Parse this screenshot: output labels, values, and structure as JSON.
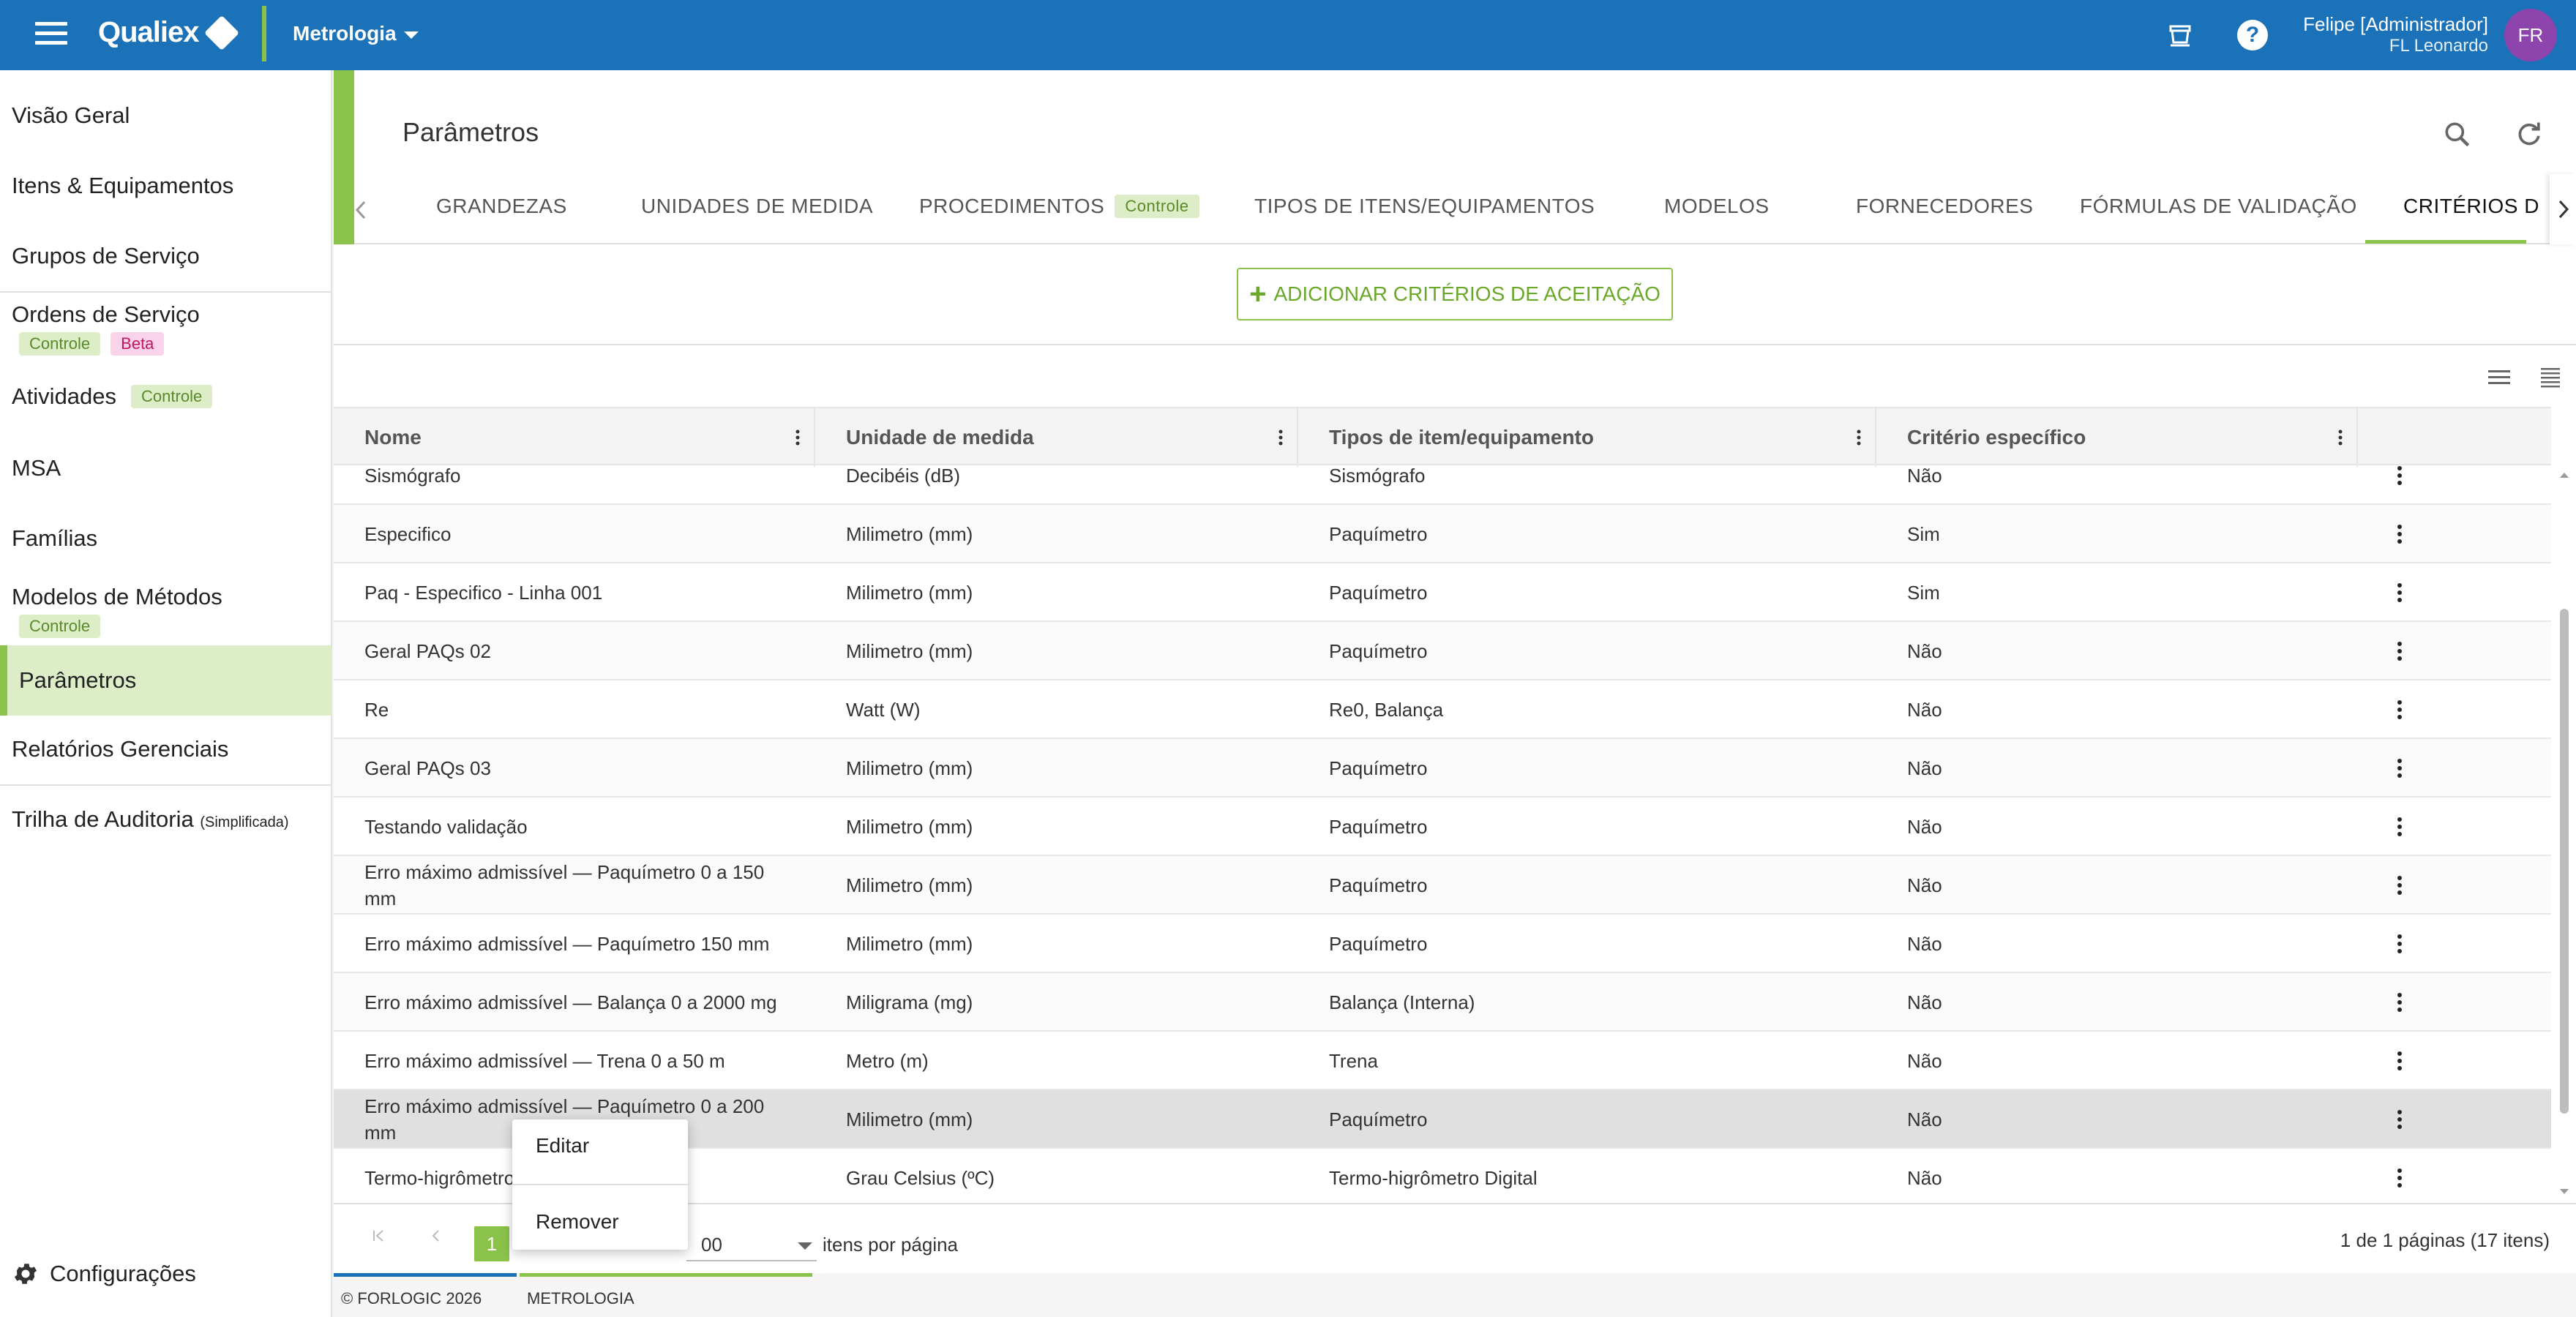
{
  "header": {
    "logo_text": "Qualiex",
    "module": "Metrologia",
    "user_name": "Felipe [Administrador]",
    "user_company": "FL Leonardo",
    "avatar_initials": "FR"
  },
  "sidebar": {
    "items": [
      {
        "label": "Visão Geral"
      },
      {
        "label": "Itens & Equipamentos"
      },
      {
        "label": "Grupos de Serviço"
      },
      {
        "label": "Ordens de Serviço",
        "badges": [
          "Controle",
          "Beta"
        ]
      },
      {
        "label": "Atividades",
        "badges": [
          "Controle"
        ]
      },
      {
        "label": "MSA"
      },
      {
        "label": "Famílias"
      },
      {
        "label": "Modelos de Métodos",
        "badges": [
          "Controle"
        ]
      },
      {
        "label": "Parâmetros",
        "active": true
      },
      {
        "label": "Relatórios Gerenciais"
      },
      {
        "label": "Trilha de Auditoria",
        "suffix": "(Simplificada)"
      }
    ],
    "settings_label": "Configurações"
  },
  "page": {
    "title": "Parâmetros",
    "add_button_label": "ADICIONAR CRITÉRIOS DE ACEITAÇÃO"
  },
  "tabs": [
    {
      "label": "GRANDEZAS"
    },
    {
      "label": "UNIDADES DE MEDIDA"
    },
    {
      "label": "PROCEDIMENTOS",
      "badge": "Controle"
    },
    {
      "label": "TIPOS DE ITENS/EQUIPAMENTOS"
    },
    {
      "label": "MODELOS"
    },
    {
      "label": "FORNECEDORES"
    },
    {
      "label": "FÓRMULAS DE VALIDAÇÃO"
    },
    {
      "label": "CRITÉRIOS D",
      "active": true
    }
  ],
  "table": {
    "columns": [
      "Nome",
      "Unidade de medida",
      "Tipos de item/equipamento",
      "Critério específico"
    ],
    "rows": [
      [
        "Sismógrafo",
        "Decibéis (dB)",
        "Sismógrafo",
        "Não"
      ],
      [
        "Especifico",
        "Milimetro (mm)",
        "Paquímetro",
        "Sim"
      ],
      [
        "Paq - Especifico - Linha 001",
        "Milimetro (mm)",
        "Paquímetro",
        "Sim"
      ],
      [
        "Geral PAQs 02",
        "Milimetro (mm)",
        "Paquímetro",
        "Não"
      ],
      [
        "Re",
        "Watt (W)",
        "Re0, Balança",
        "Não"
      ],
      [
        "Geral PAQs 03",
        "Milimetro (mm)",
        "Paquímetro",
        "Não"
      ],
      [
        "Testando validação",
        "Milimetro (mm)",
        "Paquímetro",
        "Não"
      ],
      [
        "Erro máximo admissível — Paquímetro 0 a 150 mm",
        "Milimetro (mm)",
        "Paquímetro",
        "Não"
      ],
      [
        "Erro máximo admissível — Paquímetro 150 mm",
        "Milimetro (mm)",
        "Paquímetro",
        "Não"
      ],
      [
        "Erro máximo admissível — Balança 0 a 2000 mg",
        "Miligrama (mg)",
        "Balança (Interna)",
        "Não"
      ],
      [
        "Erro máximo admissível — Trena 0 a 50 m",
        "Metro (m)",
        "Trena",
        "Não"
      ],
      [
        "Erro máximo admissível — Paquímetro 0 a 200 mm",
        "Milimetro (mm)",
        "Paquímetro",
        "Não"
      ],
      [
        "Termo-higrômetro",
        "Grau Celsius (ºC)",
        "Termo-higrômetro Digital",
        "Não"
      ]
    ]
  },
  "context_menu": {
    "edit_label": "Editar",
    "remove_label": "Remover"
  },
  "pagination": {
    "current_page": "1",
    "page_size": "00",
    "page_size_label": "itens por página",
    "info": "1 de 1 páginas (17 itens)"
  },
  "footer": {
    "copyright": "© FORLOGIC 2026",
    "module": "METROLOGIA"
  }
}
